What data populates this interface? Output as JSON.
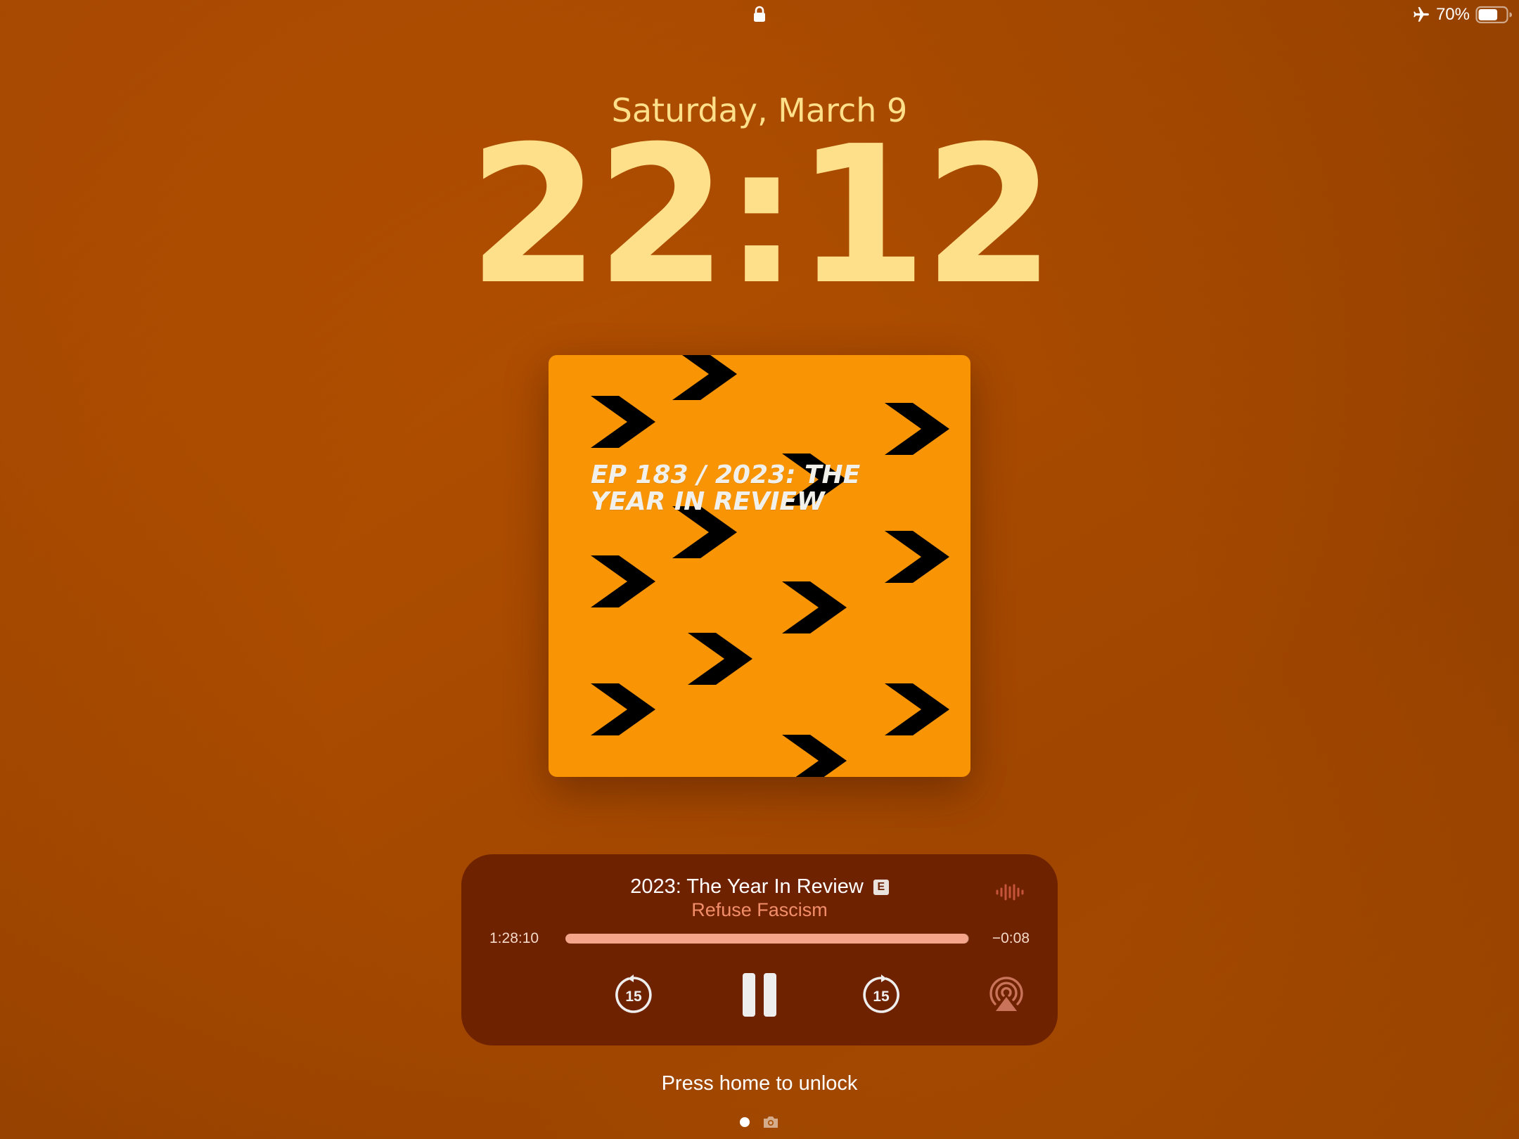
{
  "status_bar": {
    "battery_percent": "70%",
    "battery_level": 0.7,
    "icons": [
      "lock-icon",
      "airplane-icon",
      "battery-icon"
    ]
  },
  "lock_screen": {
    "date": "Saturday, March 9",
    "time": "22:12",
    "unlock_hint": "Press home to unlock"
  },
  "artwork": {
    "title": "EP 183 / 2023: THE YEAR IN REVIEW",
    "background": "#f99404"
  },
  "now_playing": {
    "title": "2023: The Year In Review",
    "explicit_badge": "E",
    "artist": "Refuse Fascism",
    "elapsed": "1:28:10",
    "remaining": "−0:08",
    "progress": 0.998,
    "controls": {
      "skip_back_seconds": "15",
      "skip_forward_seconds": "15"
    }
  },
  "colors": {
    "clock": "#ffe08a",
    "player_background": "#6a2000",
    "artist_text": "#f28e6a",
    "progress_fill": "#f4a58a"
  }
}
